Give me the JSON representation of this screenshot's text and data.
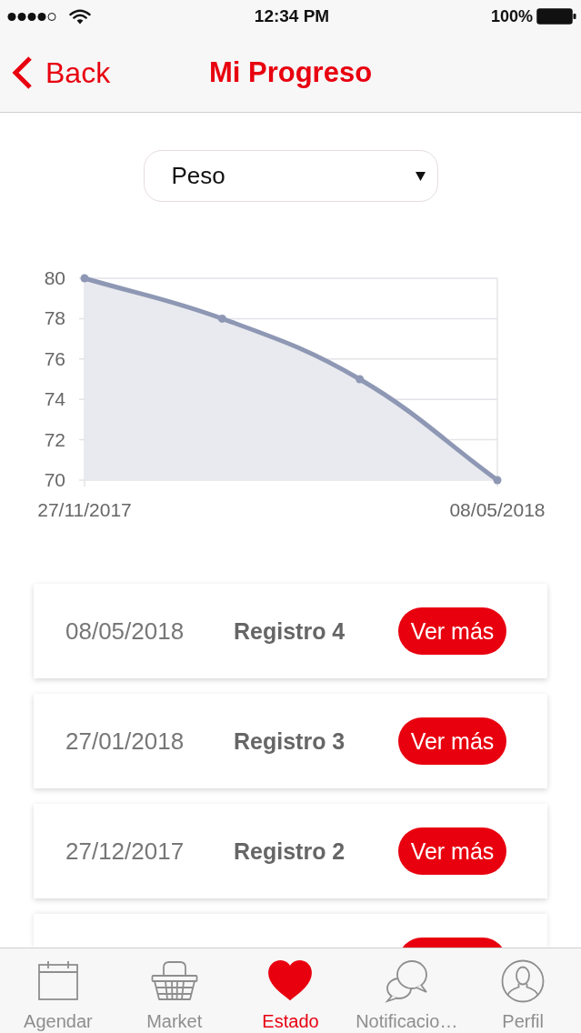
{
  "status_bar": {
    "time": "12:34 PM",
    "battery": "100%"
  },
  "nav_bar": {
    "back": "Back",
    "title": "Mi Progreso"
  },
  "selector": {
    "value": "Peso"
  },
  "progress_chart": {
    "chart_data": {
      "type": "area",
      "categories": [
        "27/11/2017",
        null,
        null,
        "08/05/2018"
      ],
      "values": [
        80,
        78,
        75,
        70
      ],
      "ylim": [
        70,
        80
      ],
      "yticks": [
        70,
        72,
        74,
        76,
        78,
        80
      ],
      "grid": true
    }
  },
  "records": [
    {
      "date": "08/05/2018",
      "title": "Registro 4",
      "button": "Ver más"
    },
    {
      "date": "27/01/2018",
      "title": "Registro 3",
      "button": "Ver más"
    },
    {
      "date": "27/12/2017",
      "title": "Registro 2",
      "button": "Ver más"
    }
  ],
  "partial_next_record": true,
  "tab_bar": [
    {
      "label": "Agendar",
      "selected": false
    },
    {
      "label": "Market",
      "selected": false
    },
    {
      "label": "Estado",
      "selected": true
    },
    {
      "label": "Notificacio…",
      "selected": false
    },
    {
      "label": "Perfil",
      "selected": false
    }
  ]
}
